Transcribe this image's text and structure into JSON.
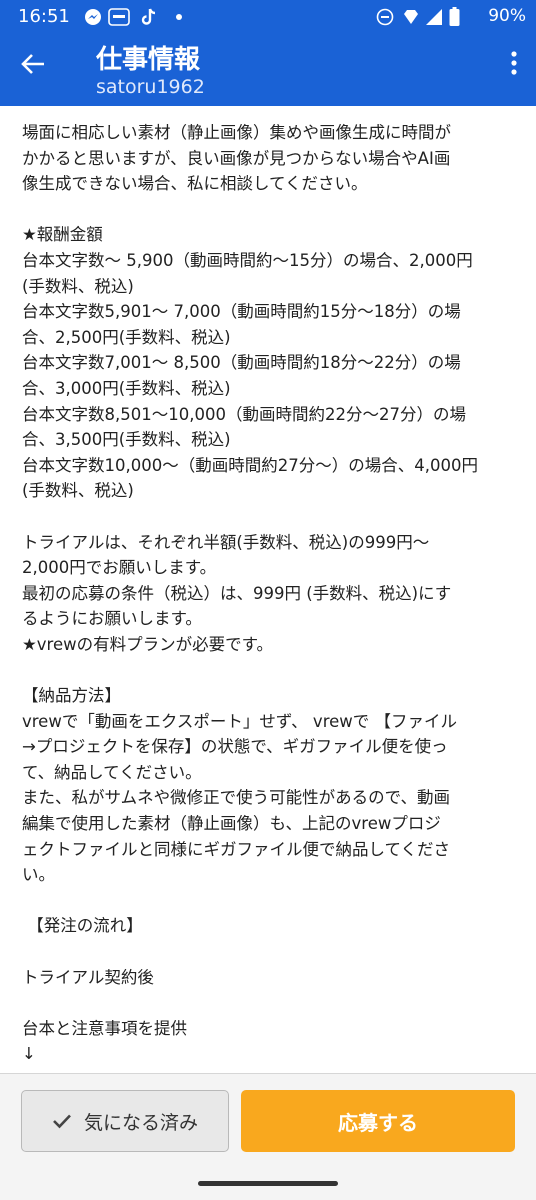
{
  "status_bar": {
    "time": "16:51",
    "left_icons": [
      "messenger-icon",
      "temu-icon",
      "tiktok-icon",
      "dot-icon"
    ],
    "right_icons": [
      "dnd-icon",
      "vpn-icon",
      "signal-icon",
      "battery-icon"
    ],
    "battery": "90%"
  },
  "header": {
    "title": "仕事情報",
    "subtitle": "satoru1962"
  },
  "content": {
    "text": "場面に相応しい素材（静止画像）集めや画像生成に時間が\nかかると思いますが、良い画像が見つからない場合やAI画\n像生成できない場合、私に相談してください。\n\n★報酬金額\n台本文字数～ 5,900（動画時間約～15分）の場合、2,000円\n(手数料、税込)\n台本文字数5,901～ 7,000（動画時間約15分～18分）の場\n合、2,500円(手数料、税込)\n台本文字数7,001～ 8,500（動画時間約18分～22分）の場\n合、3,000円(手数料、税込)\n台本文字数8,501～10,000（動画時間約22分～27分）の場\n合、3,500円(手数料、税込)\n台本文字数10,000～（動画時間約27分～）の場合、4,000円\n(手数料、税込)\n\nトライアルは、それぞれ半額(手数料、税込)の999円～\n2,000円でお願いします。\n最初の応募の条件（税込）は、999円 (手数料、税込)にす\nるようにお願いします。\n★vrewの有料プランが必要です。\n\n【納品方法】\nvrewで「動画をエクスポート」せず、 vrewで 【ファイル\n→プロジェクトを保存】の状態で、ギガファイル便を使っ\nて、納品してください。\nまた、私がサムネや微修正で使う可能性があるので、動画\n編集で使用した素材（静止画像）も、上記のvrewプロジ\nェクトファイルと同様にギガファイル便で納品してくださ\nい。\n\n 【発注の流れ】\n\nトライアル契約後\n\n台本と注意事項を提供\n↓"
  },
  "actions": {
    "favorite_label": "気になる済み",
    "apply_label": "応募する"
  },
  "colors": {
    "primary": "#1a62d6",
    "accent": "#f9a81e"
  }
}
